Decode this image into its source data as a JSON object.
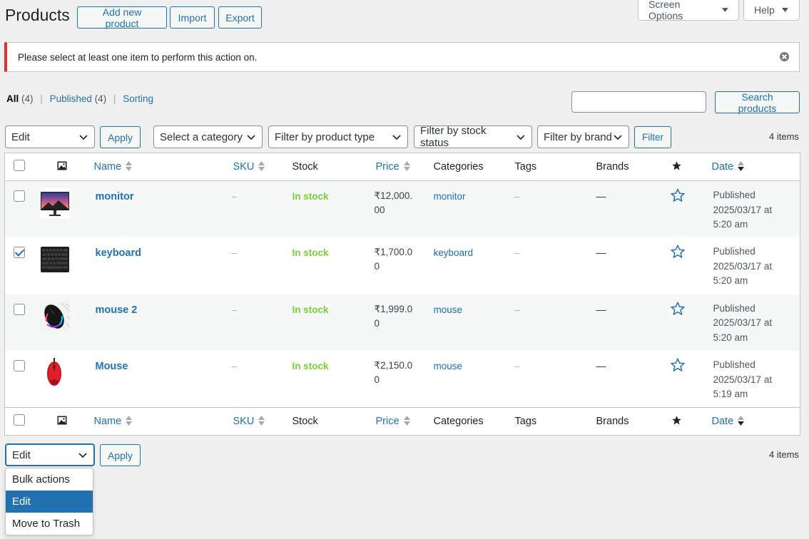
{
  "header": {
    "title": "Products",
    "add_new": "Add new product",
    "import": "Import",
    "export": "Export",
    "screen_options": "Screen Options",
    "help": "Help"
  },
  "notice": {
    "text": "Please select at least one item to perform this action on."
  },
  "views": {
    "all_label": "All",
    "all_count": "(4)",
    "published_label": "Published",
    "published_count": "(4)",
    "sorting_label": "Sorting"
  },
  "search": {
    "button": "Search products",
    "value": ""
  },
  "bulk_top": {
    "selected": "Edit",
    "apply": "Apply"
  },
  "filters": {
    "category": "Select a category",
    "product_type": "Filter by product type",
    "stock_status": "Filter by stock status",
    "brand": "Filter by brand",
    "filter_button": "Filter"
  },
  "items_count": "4 items",
  "columns": {
    "name": "Name",
    "sku": "SKU",
    "stock": "Stock",
    "price": "Price",
    "categories": "Categories",
    "tags": "Tags",
    "brands": "Brands",
    "date": "Date"
  },
  "rows": [
    {
      "name": "monitor",
      "sku": "–",
      "stock": "In stock",
      "price": "₹12,000.00",
      "category": "monitor",
      "tags": "–",
      "brands": "—",
      "date_status": "Published",
      "date_value": "2025/03/17 at",
      "date_time": "5:20 am",
      "checked": false,
      "thumb": "monitor-thumbnail"
    },
    {
      "name": "keyboard",
      "sku": "–",
      "stock": "In stock",
      "price": "₹1,700.00",
      "category": "keyboard",
      "tags": "–",
      "brands": "—",
      "date_status": "Published",
      "date_value": "2025/03/17 at",
      "date_time": "5:20 am",
      "checked": true,
      "thumb": "keyboard-thumbnail"
    },
    {
      "name": "mouse 2",
      "sku": "–",
      "stock": "In stock",
      "price": "₹1,999.00",
      "category": "mouse",
      "tags": "–",
      "brands": "—",
      "date_status": "Published",
      "date_value": "2025/03/17 at",
      "date_time": "5:20 am",
      "checked": false,
      "thumb": "mouse-rgb-thumbnail"
    },
    {
      "name": "Mouse",
      "sku": "–",
      "stock": "In stock",
      "price": "₹2,150.00",
      "category": "mouse",
      "tags": "–",
      "brands": "—",
      "date_status": "Published",
      "date_value": "2025/03/17 at",
      "date_time": "5:19 am",
      "checked": false,
      "thumb": "mouse-red-thumbnail"
    }
  ],
  "bulk_bottom": {
    "selected": "Edit",
    "apply": "Apply",
    "options": [
      "Bulk actions",
      "Edit",
      "Move to Trash"
    ],
    "highlighted_index": 1
  },
  "colors": {
    "accent": "#2271b1",
    "in_stock": "#7ad03a",
    "error": "#d63638",
    "background": "#f0f0f1"
  }
}
